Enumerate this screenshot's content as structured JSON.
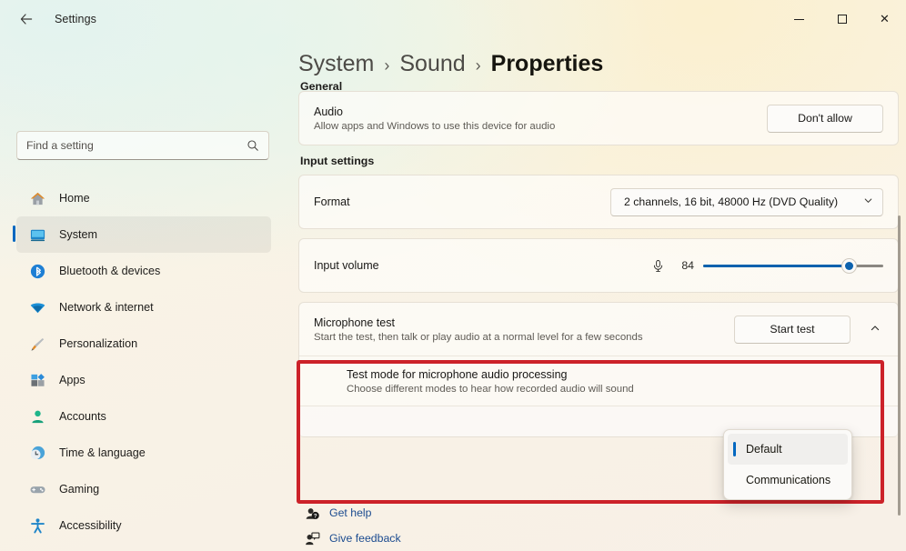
{
  "window": {
    "title": "Settings",
    "back_icon": "arrow-left-icon",
    "minimize_label": "–",
    "maximize_label": "□",
    "close_label": "✕"
  },
  "search": {
    "placeholder": "Find a setting",
    "value": "",
    "icon": "search-icon"
  },
  "sidebar": {
    "items": [
      {
        "label": "Home",
        "icon": "home-icon",
        "selected": false
      },
      {
        "label": "System",
        "icon": "display-icon",
        "selected": true
      },
      {
        "label": "Bluetooth & devices",
        "icon": "bluetooth-icon",
        "selected": false
      },
      {
        "label": "Network & internet",
        "icon": "wifi-icon",
        "selected": false
      },
      {
        "label": "Personalization",
        "icon": "brush-icon",
        "selected": false
      },
      {
        "label": "Apps",
        "icon": "apps-icon",
        "selected": false
      },
      {
        "label": "Accounts",
        "icon": "person-icon",
        "selected": false
      },
      {
        "label": "Time & language",
        "icon": "clock-icon",
        "selected": false
      },
      {
        "label": "Gaming",
        "icon": "gamepad-icon",
        "selected": false
      },
      {
        "label": "Accessibility",
        "icon": "accessibility-icon",
        "selected": false
      }
    ]
  },
  "breadcrumb": {
    "items": [
      "System",
      "Sound",
      "Properties"
    ],
    "separator": "›"
  },
  "main": {
    "general_heading": "General",
    "audio": {
      "title": "Audio",
      "subtitle": "Allow apps and Windows to use this device for audio",
      "button_label": "Don't allow"
    },
    "input_settings_heading": "Input settings",
    "format": {
      "label": "Format",
      "value": "2 channels, 16 bit, 48000 Hz (DVD Quality)",
      "chevron": "chevron-down-icon"
    },
    "input_volume": {
      "label": "Input volume",
      "value": "84",
      "percent": 84,
      "mic_icon": "microphone-icon"
    },
    "microphone_test": {
      "title": "Microphone test",
      "subtitle": "Start the test, then talk or play audio at a normal level for a few seconds",
      "button_label": "Start test",
      "collapse_icon": "chevron-up-icon"
    },
    "test_mode": {
      "title": "Test mode for microphone audio processing",
      "subtitle": "Choose different modes to hear how recorded audio will sound",
      "options": [
        "Default",
        "Communications"
      ],
      "selected": "Default"
    }
  },
  "help": {
    "links": [
      {
        "label": "Get help",
        "icon": "help-question-icon"
      },
      {
        "label": "Give feedback",
        "icon": "feedback-icon"
      }
    ]
  },
  "colors": {
    "accent": "#0067c0",
    "slider_fill": "#0d62ae",
    "annotation": "#cc2229",
    "link": "#1b4b8f"
  }
}
